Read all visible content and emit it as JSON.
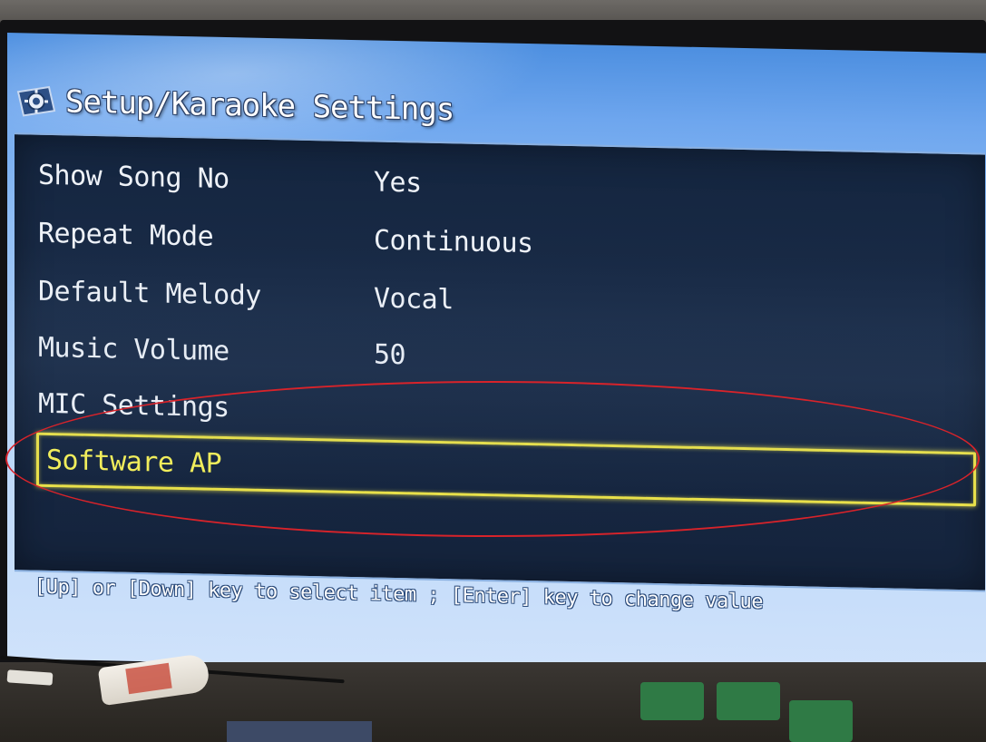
{
  "title": "Setup/Karaoke Settings",
  "menu": [
    {
      "label": "Show Song No",
      "value": "Yes"
    },
    {
      "label": "Repeat Mode",
      "value": "Continuous"
    },
    {
      "label": "Default Melody",
      "value": "Vocal"
    },
    {
      "label": "Music Volume",
      "value": "50"
    },
    {
      "label": "MIC Settings",
      "value": ""
    },
    {
      "label": "Software AP",
      "value": "",
      "selected": true
    }
  ],
  "hint": "[Up] or [Down] key to select item ; [Enter] key to change value",
  "colors": {
    "panel_bg": "#16263f",
    "text": "#eef2f8",
    "selected_text": "#f2ee5a",
    "selected_border": "#e8e04a",
    "annotation_ellipse": "#d8232a",
    "screen_gradient_top": "#4d8fe0"
  },
  "icons": {
    "title_icon": "gear-icon"
  }
}
